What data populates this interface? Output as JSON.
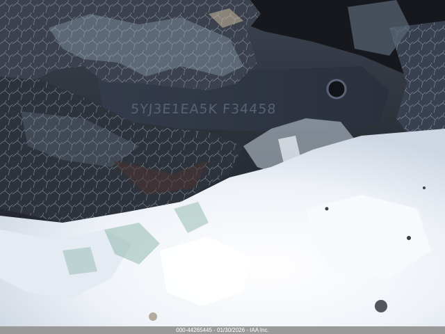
{
  "photo": {
    "subject": "shattered windshield glass over vehicle VIN plate with snow",
    "vin_text": "5YJ3E1EA5K F34458",
    "colors": {
      "dark_metal": "#2e3440",
      "plate": "#3a4253",
      "snow": "#eef2f7",
      "glass_highlight": "#c9d6e0",
      "glass_green": "#7fae9e"
    }
  },
  "caption": {
    "text": "000-44265445 - 01/30/2026 - IAA Inc."
  }
}
